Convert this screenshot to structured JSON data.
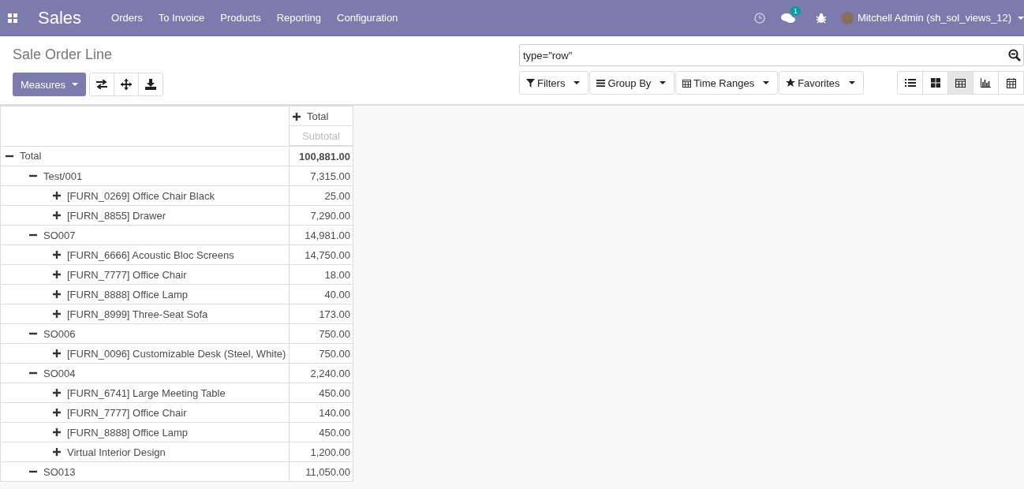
{
  "navbar": {
    "app_name": "Sales",
    "menu": [
      "Orders",
      "To Invoice",
      "Products",
      "Reporting",
      "Configuration"
    ],
    "message_count": "1",
    "user": "Mitchell Admin (sh_sol_views_12)"
  },
  "control_panel": {
    "title": "Sale Order Line",
    "measures_button": "Measures",
    "search": {
      "value": "type=\"row\""
    },
    "filters": [
      "Filters",
      "Group By",
      "Time Ranges",
      "Favorites"
    ],
    "views": [
      {
        "kind": "list",
        "selected": false
      },
      {
        "kind": "kanban",
        "selected": false
      },
      {
        "kind": "pivot",
        "selected": true
      },
      {
        "kind": "graph",
        "selected": false
      },
      {
        "kind": "calendar",
        "selected": false
      }
    ]
  },
  "pivot": {
    "column_header": "Total",
    "column_expanded": false,
    "measure": "Subtotal",
    "rows": [
      {
        "label": "Total",
        "value": "100,881.00",
        "expanded": true,
        "children": [
          {
            "label": "Test/001",
            "value": "7,315.00",
            "expanded": true,
            "children": [
              {
                "label": "[FURN_0269] Office Chair Black",
                "value": "25.00",
                "expanded": false
              },
              {
                "label": "[FURN_8855] Drawer",
                "value": "7,290.00",
                "expanded": false
              }
            ]
          },
          {
            "label": "SO007",
            "value": "14,981.00",
            "expanded": true,
            "children": [
              {
                "label": "[FURN_6666] Acoustic Bloc Screens",
                "value": "14,750.00",
                "expanded": false
              },
              {
                "label": "[FURN_7777] Office Chair",
                "value": "18.00",
                "expanded": false
              },
              {
                "label": "[FURN_8888] Office Lamp",
                "value": "40.00",
                "expanded": false
              },
              {
                "label": "[FURN_8999] Three-Seat Sofa",
                "value": "173.00",
                "expanded": false
              }
            ]
          },
          {
            "label": "SO006",
            "value": "750.00",
            "expanded": true,
            "children": [
              {
                "label": "[FURN_0096] Customizable Desk (Steel, White)",
                "value": "750.00",
                "expanded": false
              }
            ]
          },
          {
            "label": "SO004",
            "value": "2,240.00",
            "expanded": true,
            "children": [
              {
                "label": "[FURN_6741] Large Meeting Table",
                "value": "450.00",
                "expanded": false
              },
              {
                "label": "[FURN_7777] Office Chair",
                "value": "140.00",
                "expanded": false
              },
              {
                "label": "[FURN_8888] Office Lamp",
                "value": "450.00",
                "expanded": false
              },
              {
                "label": "Virtual Interior Design",
                "value": "1,200.00",
                "expanded": false
              }
            ]
          },
          {
            "label": "SO013",
            "value": "11,050.00",
            "expanded": true
          }
        ]
      }
    ]
  }
}
